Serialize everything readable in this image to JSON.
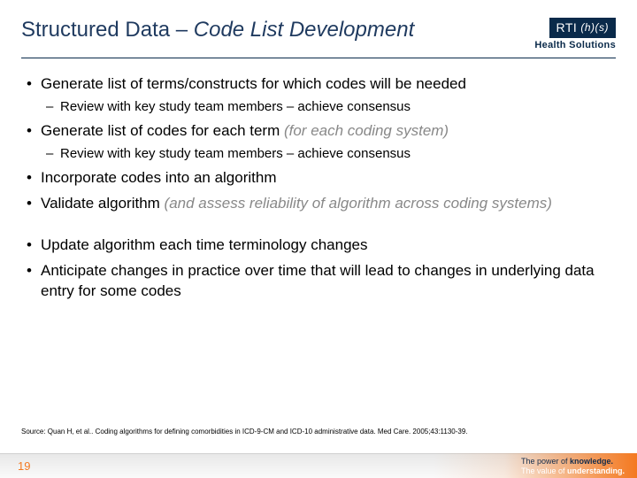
{
  "title": {
    "pre": "Structured Data – ",
    "emph": "Code List Development"
  },
  "logo": {
    "brand_pre": "RTI",
    "brand_mid": "(h)(s)",
    "sub": "Health Solutions"
  },
  "bullets1": [
    {
      "text": "Generate list of terms/constructs for which codes will be needed",
      "sub": [
        "Review with key study team members – achieve consensus"
      ]
    },
    {
      "text": "Generate list of codes for each term ",
      "tail_gray": "(for each coding system)",
      "sub": [
        "Review with key study team members – achieve consensus"
      ]
    },
    {
      "text": "Incorporate codes into an algorithm"
    },
    {
      "text": "Validate algorithm ",
      "tail_gray": "(and assess reliability of algorithm across coding systems)"
    }
  ],
  "bullets2": [
    {
      "text": "Update algorithm each time terminology changes"
    },
    {
      "text": "Anticipate changes in practice over time that will lead to changes in underlying data entry for some codes"
    }
  ],
  "source": "Source: Quan H, et al.. Coding algorithms for defining comorbidities in ICD-9-CM and ICD-10 administrative data. Med Care. 2005;43:1130-39.",
  "page_number": "19",
  "tagline": {
    "l1a": "The power of ",
    "l1b": "knowledge.",
    "l2a": "The value of ",
    "l2b": "understanding."
  }
}
